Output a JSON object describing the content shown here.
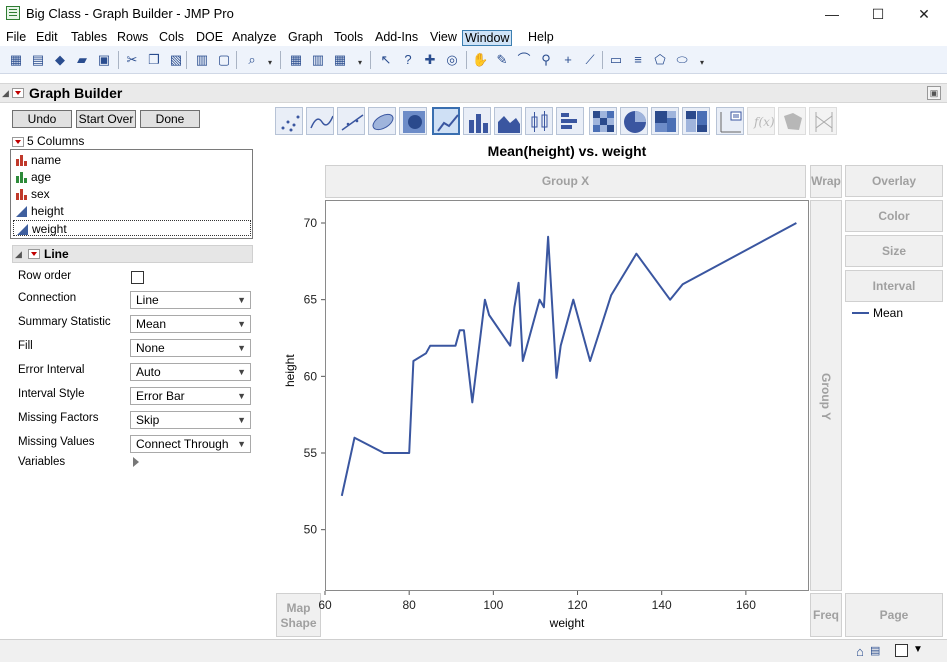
{
  "window": {
    "title": "Big Class - Graph Builder - JMP Pro",
    "min_glyph": "—",
    "max_glyph": "☐",
    "close_glyph": "✕"
  },
  "menu": [
    "File",
    "Edit",
    "Tables",
    "Rows",
    "Cols",
    "DOE",
    "Analyze",
    "Graph",
    "Tools",
    "Add-Ins",
    "View",
    "Window",
    "Help"
  ],
  "menu_active": "Window",
  "toolbar_icons": [
    "new-data-table-icon",
    "new-script-icon",
    "python-icon",
    "open-icon",
    "save-icon",
    "cut-icon",
    "copy-icon",
    "paste-icon",
    "data-grid-icon",
    "lock-icon",
    "search-icon",
    "window-list-icon",
    "tile-icon",
    "grid-icon",
    "arrow-icon",
    "help-icon",
    "crosshair-icon",
    "globe-icon",
    "hand-icon",
    "brush-icon",
    "lasso-icon",
    "magnifier-icon",
    "plus-icon",
    "ruler-icon",
    "text-annotate-icon",
    "line-icon",
    "polygon-icon",
    "ellipse-icon"
  ],
  "graph_builder": {
    "title": "Graph Builder",
    "undo": "Undo",
    "start_over": "Start Over",
    "done": "Done",
    "columns_header": "5 Columns",
    "columns": [
      {
        "name": "name",
        "type": "nominal"
      },
      {
        "name": "age",
        "type": "ordinal"
      },
      {
        "name": "sex",
        "type": "nominal"
      },
      {
        "name": "height",
        "type": "continuous"
      },
      {
        "name": "weight",
        "type": "continuous"
      }
    ],
    "selected_column": "weight",
    "element": "Line",
    "props": {
      "row_order": "Row order",
      "connection_label": "Connection",
      "connection": "Line",
      "summary_label": "Summary Statistic",
      "summary": "Mean",
      "fill_label": "Fill",
      "fill": "None",
      "error_interval_label": "Error Interval",
      "error_interval": "Auto",
      "interval_style_label": "Interval Style",
      "interval_style": "Error Bar",
      "missing_factors_label": "Missing Factors",
      "missing_factors": "Skip",
      "missing_values_label": "Missing Values",
      "missing_values": "Connect Through",
      "variables_label": "Variables"
    },
    "graph_types": [
      "points",
      "smoother",
      "line-of-fit",
      "ellipse",
      "contour",
      "line",
      "bar",
      "area",
      "box-plot",
      "histogram",
      "heatmap",
      "pie",
      "treemap",
      "mosaic",
      "caption-box",
      "formula",
      "map-shapes",
      "parallel"
    ],
    "selected_graph_type": "line",
    "zones": {
      "group_x": "Group X",
      "wrap": "Wrap",
      "overlay": "Overlay",
      "color": "Color",
      "size": "Size",
      "interval": "Interval",
      "group_y": "Group Y",
      "map_shape_1": "Map",
      "map_shape_2": "Shape",
      "freq": "Freq",
      "page": "Page"
    },
    "legend": {
      "label": "Mean",
      "color": "#3a56a0"
    }
  },
  "chart_data": {
    "type": "line",
    "title": "Mean(height) vs. weight",
    "xlabel": "weight",
    "ylabel": "height",
    "xlim": [
      60,
      175
    ],
    "ylim": [
      46,
      71.5
    ],
    "xticks": [
      60,
      80,
      100,
      120,
      140,
      160
    ],
    "yticks": [
      50,
      55,
      60,
      65,
      70
    ],
    "grid": false,
    "legend_position": "right",
    "series": [
      {
        "name": "Mean",
        "color": "#3a56a0",
        "x": [
          64,
          67,
          74,
          79,
          80,
          81,
          84,
          85,
          91,
          92,
          93,
          95,
          98,
          99,
          104,
          105,
          106,
          107,
          111,
          112,
          113,
          115,
          116,
          119,
          123,
          128,
          134,
          142,
          145,
          172
        ],
        "y": [
          52.2,
          56,
          55,
          55,
          55,
          61,
          61.5,
          62,
          62,
          63,
          63,
          58.3,
          65,
          64,
          62,
          64.5,
          66.1,
          61,
          65,
          64.5,
          69.1,
          59.9,
          62,
          65,
          61,
          65.3,
          68,
          65,
          66,
          70
        ]
      }
    ]
  }
}
